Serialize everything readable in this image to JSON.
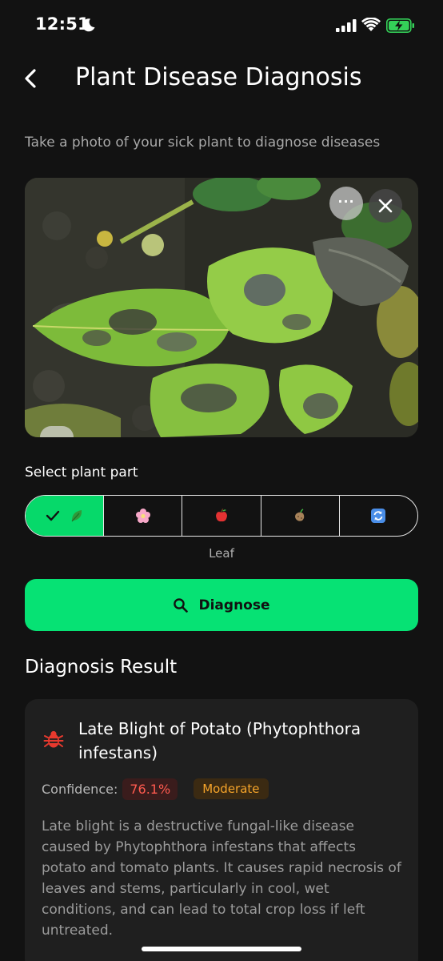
{
  "status_bar": {
    "time": "12:51"
  },
  "header": {
    "title": "Plant Disease Diagnosis"
  },
  "subtitle": "Take a photo of your sick plant to diagnose diseases",
  "photo": {
    "more_label": "···"
  },
  "plant_part": {
    "heading": "Select plant part",
    "options": [
      {
        "icon": "check-leaf-icon",
        "selected": true
      },
      {
        "icon": "flower-icon",
        "selected": false
      },
      {
        "icon": "fruit-icon",
        "selected": false
      },
      {
        "icon": "root-icon",
        "selected": false
      },
      {
        "icon": "refresh-icon",
        "selected": false
      }
    ],
    "selected_label": "Leaf"
  },
  "diagnose_button": {
    "label": "Diagnose"
  },
  "result": {
    "heading": "Diagnosis Result",
    "disease_name": "Late Blight of Potato (Phytophthora infestans)",
    "confidence_label": "Confidence:",
    "confidence_value": "76.1%",
    "severity": "Moderate",
    "description": "Late blight is a destructive fungal-like disease caused by Phytophthora infestans that affects potato and tomato plants. It causes rapid necrosis of leaves and stems, particularly in cool, wet conditions, and can lead to total crop loss if left untreated."
  },
  "colors": {
    "accent": "#06e274",
    "background": "#121212",
    "card": "#1f1f1f",
    "danger": "#ff5a4f",
    "warning": "#f5a42a"
  }
}
